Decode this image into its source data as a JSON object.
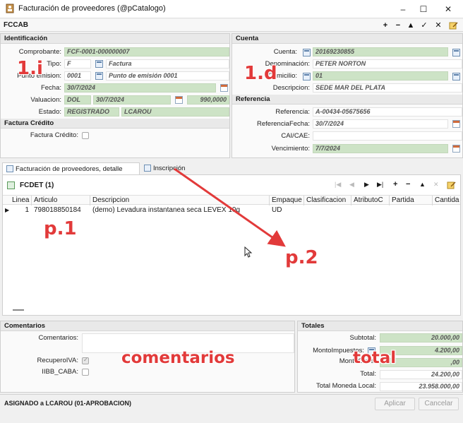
{
  "window": {
    "title": "Facturación de proveedores (@pCatalogo)",
    "minimize": "–",
    "maximize": "☐",
    "close": "✕"
  },
  "header": {
    "code": "FCCAB",
    "tools": [
      "+",
      "−",
      "▲",
      "✓",
      "✕"
    ]
  },
  "identificacion": {
    "title": "Identificación",
    "comprobante_label": "Comprobante:",
    "comprobante": "FCF-0001-000000007",
    "tipo_label": "Tipo:",
    "tipo_code": "F",
    "tipo_desc": "Factura",
    "punto_label": "Punto emision:",
    "punto_code": "0001",
    "punto_desc": "Punto de emisión 0001",
    "fecha_label": "Fecha:",
    "fecha": "30/7/2024",
    "valuacion_label": "Valuacion:",
    "val_moneda": "DOL",
    "val_fecha": "30/7/2024",
    "val_monto": "990,0000",
    "estado_label": "Estado:",
    "estado": "REGISTRADO",
    "estado_user": "LCAROU"
  },
  "factura_credito": {
    "title": "Factura Crédito",
    "label": "Factura Crédito:"
  },
  "cuenta": {
    "title": "Cuenta",
    "cuenta_label": "Cuenta:",
    "cuenta": "20169230855",
    "denominacion_label": "Denominación:",
    "denominacion": "PETER NORTON",
    "domicilio_label": "Domicilio:",
    "domicilio": "01",
    "descripcion_label": "Descripcion:",
    "descripcion": "SEDE MAR DEL PLATA"
  },
  "referencia": {
    "title": "Referencia",
    "referencia_label": "Referencia:",
    "referencia": "A-00434-05675656",
    "reffecha_label": "ReferenciaFecha:",
    "reffecha": "30/7/2024",
    "cai_label": "CAI/CAE:",
    "cai": "",
    "venc_label": "Vencimiento:",
    "vencimiento": "7/7/2024"
  },
  "tabs": [
    {
      "label": "Facturación de proveedores, detalle"
    },
    {
      "label": "Inscripción"
    }
  ],
  "detail": {
    "title": "FCDET (1)",
    "columns": [
      "Linea",
      "Articulo",
      "Descripcion",
      "Empaque",
      "Clasificacion",
      "AtributoC",
      "Partida",
      "Cantida"
    ],
    "rows": [
      {
        "linea": "1",
        "articulo": "798018850184",
        "descripcion": "(demo) Levadura instantanea seca LEVEX 10g",
        "empaque": "UD"
      }
    ],
    "nav": [
      "|◀",
      "◀",
      "▶",
      "▶|",
      "+",
      "−",
      "▲",
      "✕"
    ]
  },
  "comentarios": {
    "title": "Comentarios",
    "comentarios_label": "Comentarios:",
    "recupero_label": "RecuperoIVA:",
    "iibb_label": "IIBB_CABA:"
  },
  "totales": {
    "title": "Totales",
    "subtotal_label": "Subtotal:",
    "subtotal": "20.000,00",
    "impuestos_label": "MontoImpuestos:",
    "impuestos": "4.200,00",
    "otros_label": "MontoOtros:",
    "otros": ",00",
    "total_label": "Total:",
    "total": "24.200,00",
    "local_label": "Total Moneda Local:",
    "local": "23.958.000,00"
  },
  "footer": {
    "status": "ASIGNADO a LCAROU (01-APROBACION)",
    "aplicar": "Aplicar",
    "cancelar": "Cancelar"
  },
  "annotations": {
    "a1": "1.i",
    "a2": "1.d",
    "a3": "p.1",
    "a4": "p.2",
    "a5": "comentarios",
    "a6": "total"
  },
  "colors": {
    "readonly_field": "#cde3c6",
    "annotation": "#e23a3a"
  }
}
